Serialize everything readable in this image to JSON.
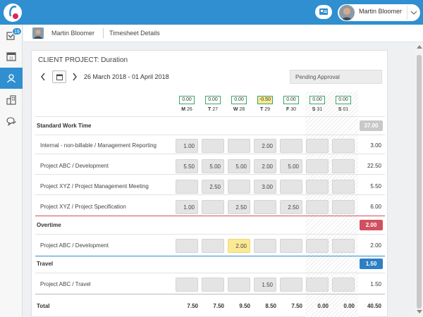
{
  "header": {
    "user_name": "Martin Bloomer",
    "colors": {
      "primary": "#2f8fd0",
      "logo_accent": "#e0245e"
    }
  },
  "sidebar": {
    "items": [
      {
        "icon": "tasks-check-icon",
        "badge": "19"
      },
      {
        "icon": "calendar-icon",
        "calendar_day": "21"
      },
      {
        "icon": "user-icon",
        "active": true
      },
      {
        "icon": "buildings-icon"
      },
      {
        "icon": "chat-icon"
      }
    ]
  },
  "subheader": {
    "user_name": "Martin Bloomer",
    "breadcrumb": "Timesheet Details"
  },
  "panel": {
    "title": "CLIENT PROJECT: Duration",
    "date_range": "26 March 2018 - 01 April 2018",
    "status": "Pending Approval"
  },
  "days": [
    {
      "balance": "0.00",
      "dow": "M",
      "date": "26",
      "warn": false
    },
    {
      "balance": "0.00",
      "dow": "T",
      "date": "27",
      "warn": false
    },
    {
      "balance": "0.00",
      "dow": "W",
      "date": "28",
      "warn": false
    },
    {
      "balance": "-0.50",
      "dow": "T",
      "date": "29",
      "warn": true
    },
    {
      "balance": "0.00",
      "dow": "F",
      "date": "30",
      "warn": false
    },
    {
      "balance": "0.00",
      "dow": "S",
      "date": "31",
      "warn": false
    },
    {
      "balance": "0.00",
      "dow": "S",
      "date": "01",
      "warn": false
    }
  ],
  "sections": [
    {
      "label": "Standard Work Time",
      "total": "37.00",
      "color": "#c8c8c8",
      "rows": [
        {
          "label": "Internal - non-billable / Management Reporting",
          "values": [
            "1.00",
            "",
            "",
            "2.00",
            "",
            "",
            ""
          ],
          "total": "3.00"
        },
        {
          "label": "Project ABC / Development",
          "values": [
            "5.50",
            "5.00",
            "5.00",
            "2.00",
            "5.00",
            "",
            ""
          ],
          "total": "22.50"
        },
        {
          "label": "Project XYZ / Project Management Meeting",
          "values": [
            "",
            "2.50",
            "",
            "3.00",
            "",
            "",
            ""
          ],
          "total": "5.50"
        },
        {
          "label": "Project XYZ / Project Specification",
          "values": [
            "1.00",
            "",
            "2.50",
            "",
            "2.50",
            "",
            ""
          ],
          "total": "6.00"
        }
      ]
    },
    {
      "label": "Overtime",
      "total": "2.00",
      "color": "#d0505f",
      "rows": [
        {
          "label": "Project ABC / Development",
          "values": [
            "",
            "",
            "2.00",
            "",
            "",
            "",
            ""
          ],
          "highlight": 2,
          "total": "2.00"
        }
      ]
    },
    {
      "label": "Travel",
      "total": "1.50",
      "color": "#2f7fc4",
      "rows": [
        {
          "label": "Project ABC / Travel",
          "values": [
            "",
            "",
            "",
            "1.50",
            "",
            "",
            ""
          ],
          "total": "1.50"
        }
      ]
    }
  ],
  "totals": {
    "label": "Total",
    "values": [
      "7.50",
      "7.50",
      "9.50",
      "8.50",
      "7.50",
      "0.00",
      "0.00"
    ],
    "grand_total": "40.50"
  }
}
